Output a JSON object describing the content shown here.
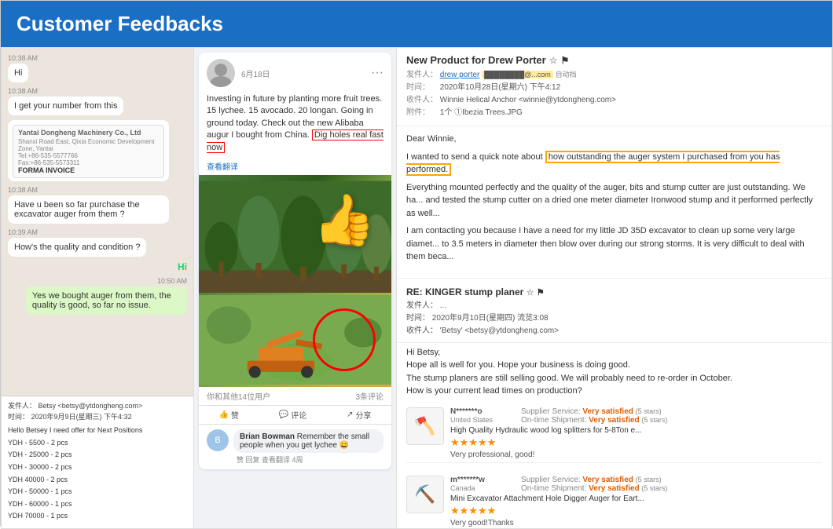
{
  "header": {
    "title": "Customer Feedbacks",
    "bg_color": "#1a6fc4"
  },
  "left_panel": {
    "chat": {
      "messages": [
        {
          "type": "received",
          "time": "10:38 AM",
          "text": "Hi"
        },
        {
          "type": "received",
          "time": "10:38 AM",
          "text": "I get your number from this"
        },
        {
          "type": "received",
          "time": "10:38 AM",
          "text": "[invoice image]"
        },
        {
          "type": "received",
          "time": "10:38 AM",
          "text": "Have u been so far purchase the excavator auger from them ?"
        },
        {
          "type": "received",
          "time": "10:39 AM",
          "text": "How's the quality and condition ?"
        },
        {
          "type": "sent_hi",
          "text": "Hi"
        },
        {
          "type": "sent",
          "time": "10:50 AM",
          "text": "Yes we bought auger from them, the quality is good, so far no issue."
        }
      ],
      "invoice": {
        "company": "Yantai Dongheng Machinery Co., Ltd",
        "address": "Shanxi Road East, Qixia Economic Development Zone, Yantai",
        "tel": "Tel:+86-535-5577766",
        "fax": "Fax:+86-535-5573311",
        "title": "FORMA INVOICE"
      }
    },
    "email": {
      "from_label": "发件人：",
      "from": "Betsy <betsy@ytdongheng.com>",
      "date_label": "时间：",
      "date": "2020年9月9日(星期三) 下午4:32",
      "body": [
        "Hello Betsey I need offer for Next Positions",
        "YDH - 5500 - 2 pcs",
        "YDH - 25000 - 2 pcs",
        "YDH - 30000 - 2 pcs",
        "YDH 40000 - 2 pcs",
        "YDH - 50000 - 1 pcs",
        "YDH - 60000 - 1 pcs",
        "YDH 70000 - 1 pcs"
      ]
    }
  },
  "mid_panel": {
    "post": {
      "date": "6月18日",
      "text_parts": [
        "Investing in future by planting more fruit trees. 15 lychee. 15 avocado. 20 longan. Going in ground today. Check out the new Alibaba augur I bought from China.",
        "Dig holes real fast now"
      ],
      "reactions": "你和其他14位用户",
      "comment_count": "3条评论",
      "actions": [
        "赞",
        "评论",
        "分享"
      ],
      "commenter_name": "Brian Bowman",
      "comment_text": "Remember the small people when you get lychee 😄",
      "comment_meta": "赞 回复 查看翻译 4周"
    }
  },
  "right_panel": {
    "email1": {
      "subject": "New Product for Drew Porter",
      "from_label": "发件人：",
      "from": "drew porter",
      "from_domain": "@...com",
      "auto_label": "自动档",
      "date_label": "时间：",
      "date": "2020年10月28日(星期六) 下午4:12",
      "to_label": "收件人：",
      "to": "Winnie Helical Anchor <winnie@ytdongheng.com>",
      "attachment_label": "附件：",
      "attachment": "1个 ①Ibezia Trees.JPG",
      "greeting": "Dear Winnie,",
      "highlight_text": "I wanted to send a quick note about how outstanding the auger system I purchased from you has performed.",
      "body_text": "Everything mounted perfectly and the quality of the auger, bits and stump cutter are just outstanding. We ha... and tested the stump cutter on a dried one meter diameter Ironwood stump and it performed perfectly as well...",
      "body_text2": "I am contacting you because I have a need for my little JD 35D excavator to clean up some very large diamet... to 3.5 meters in diameter then blow over during our strong storms. It is very difficult to deal with them beca..."
    },
    "email2": {
      "subject": "RE: KINGER stump planer",
      "from_label": "发件人：",
      "from": "...",
      "date_label": "时间：",
      "date": "2020年9月10日(星期四) 流览3:08",
      "to_label": "收件人：",
      "to": "'Betsy' <betsy@ytdongheng.com>",
      "greeting": "Hi Betsy,",
      "lines": [
        "Hope all is well for you. Hope your business is doing good.",
        "The stump planers are still selling good. We will probably need to re-order in October.",
        "How is your current lead times on production?"
      ]
    },
    "reviews": [
      {
        "user": "N*******o",
        "country": "United States",
        "supplier_service_label": "Supplier Service:",
        "supplier_service_value": "Very satisfied",
        "supplier_service_stars": "(5 stars)",
        "shipment_label": "On-time Shipment:",
        "shipment_value": "Very satisfied",
        "shipment_stars": "(5 stars)",
        "product_title": "High Quality Hydraulic wood log splitters for 5-8Ton e...",
        "stars": "★★★★★",
        "review_text": "Very professional, good!",
        "icon": "🪓"
      },
      {
        "user": "m*******w",
        "country": "Canada",
        "supplier_service_label": "Supplier Service:",
        "supplier_service_value": "Very satisfied",
        "supplier_service_stars": "(5 stars)",
        "shipment_label": "On-time Shipment:",
        "shipment_value": "Very satisfied",
        "shipment_stars": "(5 stars)",
        "product_title": "Mini Excavator Attachment Hole Digger Auger for Eart...",
        "stars": "★★★★★",
        "review_text": "Very good!Thanks",
        "icon": "⛏️"
      }
    ]
  }
}
